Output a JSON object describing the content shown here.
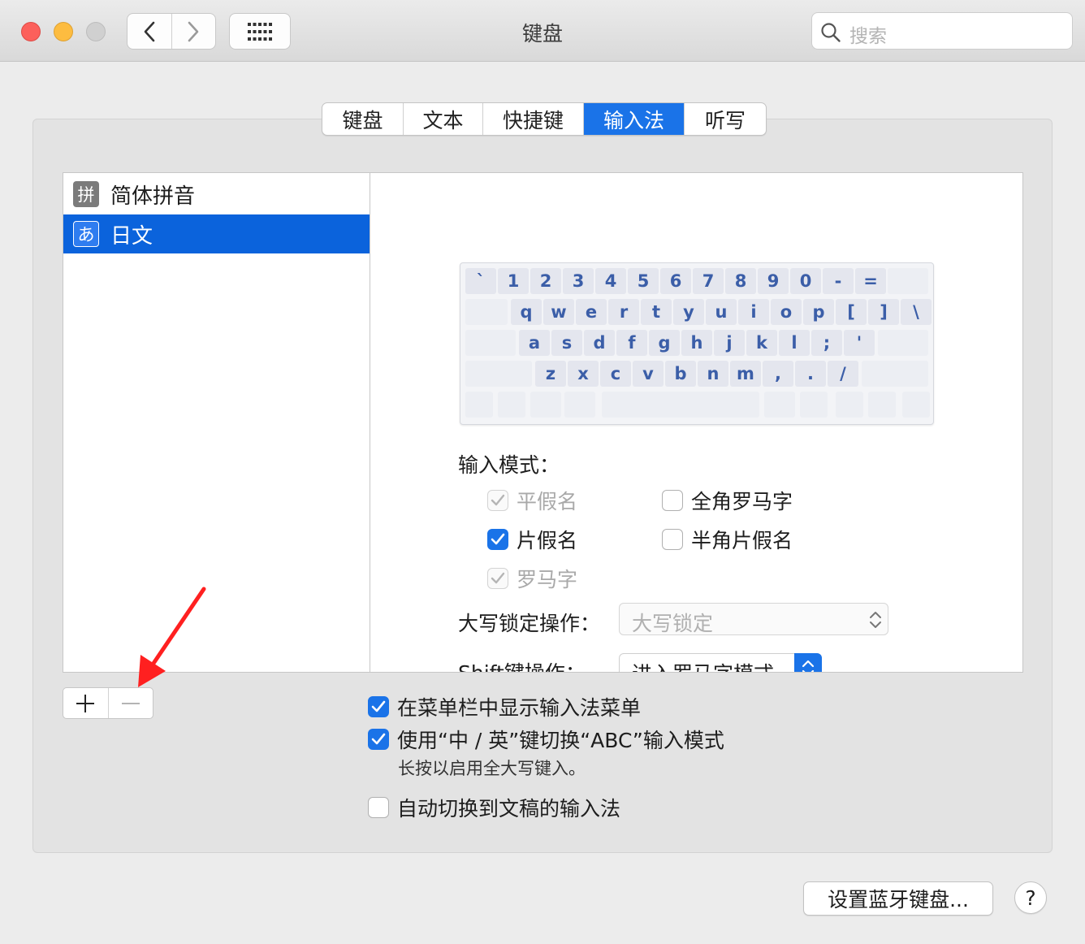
{
  "window": {
    "title": "键盘"
  },
  "search": {
    "placeholder": "搜索"
  },
  "tabs": [
    {
      "label": "键盘",
      "active": false
    },
    {
      "label": "文本",
      "active": false
    },
    {
      "label": "快捷键",
      "active": false
    },
    {
      "label": "输入法",
      "active": true
    },
    {
      "label": "听写",
      "active": false
    }
  ],
  "sources": [
    {
      "icon_char": "拼",
      "label": "简体拼音",
      "icon_color": "#7b7b7b",
      "selected": false
    },
    {
      "icon_char": "あ",
      "label": "日文",
      "icon_color": "#2f7df0",
      "selected": true
    }
  ],
  "keyboard": {
    "row1": [
      "`",
      "1",
      "2",
      "3",
      "4",
      "5",
      "6",
      "7",
      "8",
      "9",
      "0",
      "-",
      "="
    ],
    "row2": [
      "q",
      "w",
      "e",
      "r",
      "t",
      "y",
      "u",
      "i",
      "o",
      "p",
      "[",
      "]",
      "\\"
    ],
    "row3": [
      "a",
      "s",
      "d",
      "f",
      "g",
      "h",
      "j",
      "k",
      "l",
      ";",
      "'"
    ],
    "row4": [
      "z",
      "x",
      "c",
      "v",
      "b",
      "n",
      "m",
      ",",
      ".",
      "/"
    ]
  },
  "input_modes": {
    "label": "输入模式：",
    "options": [
      {
        "label": "平假名",
        "checked": true,
        "disabled": true
      },
      {
        "label": "全角罗马字",
        "checked": false,
        "disabled": false
      },
      {
        "label": "片假名",
        "checked": true,
        "disabled": false
      },
      {
        "label": "半角片假名",
        "checked": false,
        "disabled": false
      },
      {
        "label": "罗马字",
        "checked": true,
        "disabled": true
      }
    ]
  },
  "caps_lock": {
    "label": "大写锁定操作：",
    "value": "大写锁定"
  },
  "shift": {
    "label": "Shift键操作：",
    "value": "进入罗马字模式"
  },
  "list_controls": {
    "add": "+",
    "remove": "−"
  },
  "options": [
    {
      "label": "在菜单栏中显示输入法菜单",
      "checked": true
    },
    {
      "label": "使用“中 / 英”键切换“ABC”输入模式",
      "checked": true
    },
    {
      "label": "自动切换到文稿的输入法",
      "checked": false
    }
  ],
  "caps_hint": "长按以启用全大写键入。",
  "bluetooth_button": "设置蓝牙键盘...",
  "help_button": "?",
  "colors": {
    "accent": "#1a73e8",
    "selection": "#0b63dc",
    "annotation_arrow": "#ff2020"
  }
}
